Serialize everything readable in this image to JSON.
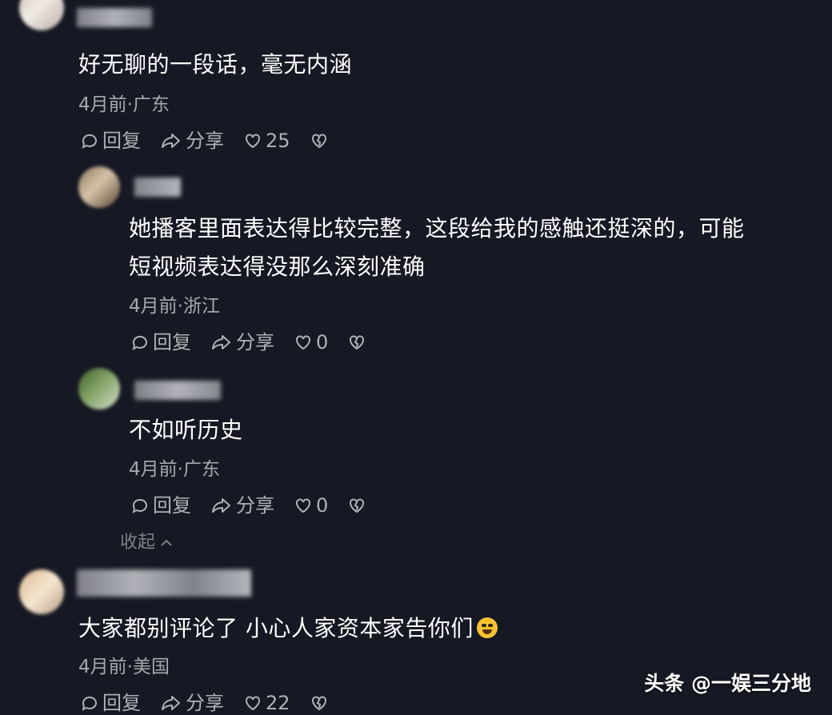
{
  "comments": [
    {
      "text": "好无聊的一段话，毫无内涵",
      "meta": "4月前·广东",
      "reply_label": "回复",
      "share_label": "分享",
      "likes": "25"
    },
    {
      "text_line1": "她播客里面表达得比较完整，这段给我的感触还挺深的，可能",
      "text_line2": "短视频表达得没那么深刻准确",
      "meta": "4月前·浙江",
      "reply_label": "回复",
      "share_label": "分享",
      "likes": "0"
    },
    {
      "text": "不如听历史",
      "meta": "4月前·广东",
      "reply_label": "回复",
      "share_label": "分享",
      "likes": "0"
    },
    {
      "text": "大家都别评论了 小心人家资本家告你们",
      "meta": "4月前·美国",
      "reply_label": "回复",
      "share_label": "分享",
      "likes": "22"
    }
  ],
  "collapse_label": "收起",
  "watermark": "头条 @一娱三分地",
  "icons": {
    "reply": "reply-bubble-icon",
    "share": "share-arrow-icon",
    "like": "heart-icon",
    "dislike": "broken-heart-icon",
    "collapse": "chevron-up-icon",
    "emoji": "crying-laughing-emoji"
  },
  "colors": {
    "background": "#161823",
    "text": "#ffffff",
    "meta": "#9fa0a6"
  }
}
